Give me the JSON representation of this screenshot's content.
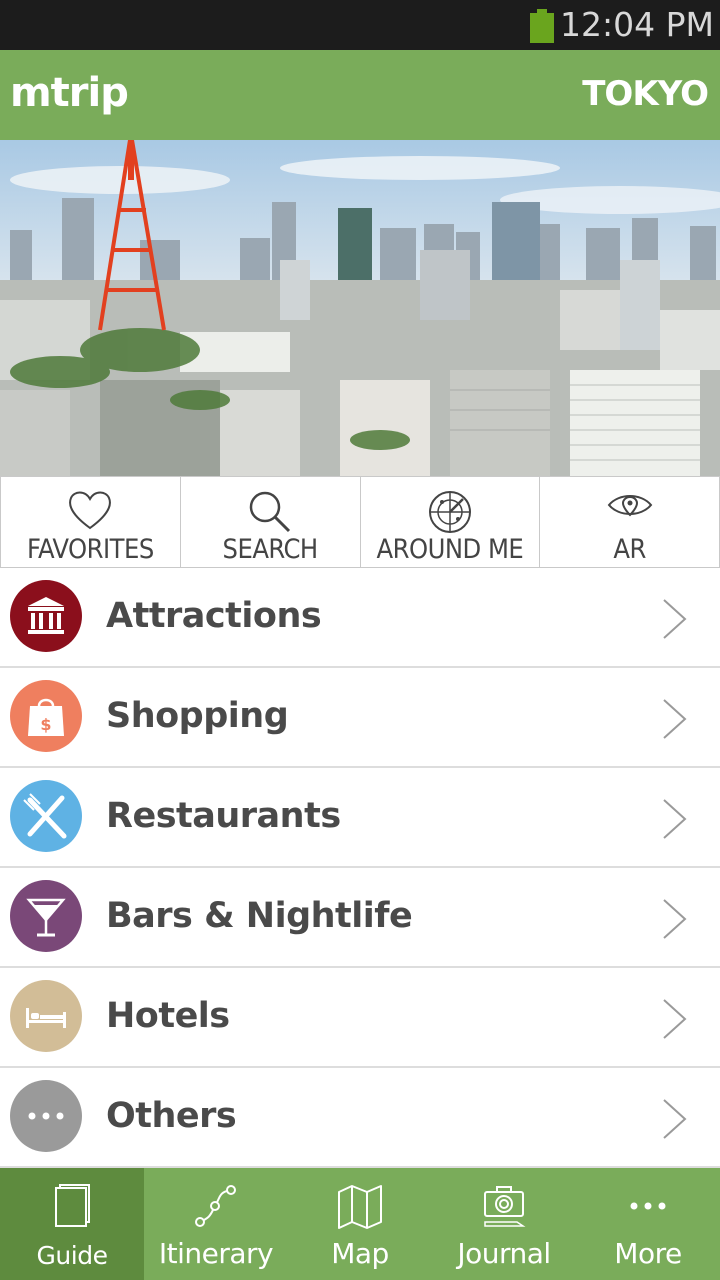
{
  "status_bar": {
    "time": "12:04 PM",
    "battery_color": "#6aa51e"
  },
  "header": {
    "logo": "mtrip",
    "city": "TOKYO",
    "color": "#7aac5a"
  },
  "quick_actions": [
    {
      "label": "FAVORITES",
      "icon": "heart-icon"
    },
    {
      "label": "SEARCH",
      "icon": "search-icon"
    },
    {
      "label": "AROUND ME",
      "icon": "radar-icon"
    },
    {
      "label": "AR",
      "icon": "eye-icon"
    }
  ],
  "categories": [
    {
      "label": "Attractions",
      "icon": "museum-icon",
      "color": "#8b0f1c"
    },
    {
      "label": "Shopping",
      "icon": "shopping-bag-icon",
      "color": "#ef7f5f"
    },
    {
      "label": "Restaurants",
      "icon": "fork-knife-icon",
      "color": "#5fb2e4"
    },
    {
      "label": "Bars & Nightlife",
      "icon": "cocktail-icon",
      "color": "#7a4878"
    },
    {
      "label": "Hotels",
      "icon": "bed-icon",
      "color": "#d2bd97"
    },
    {
      "label": "Others",
      "icon": "ellipsis-icon",
      "color": "#9a9a9a"
    }
  ],
  "tabs": [
    {
      "label": "Guide",
      "icon": "book-icon",
      "active": true
    },
    {
      "label": "Itinerary",
      "icon": "route-icon",
      "active": false
    },
    {
      "label": "Map",
      "icon": "map-icon",
      "active": false
    },
    {
      "label": "Journal",
      "icon": "camera-icon",
      "active": false
    },
    {
      "label": "More",
      "icon": "more-dots-icon",
      "active": false
    }
  ]
}
